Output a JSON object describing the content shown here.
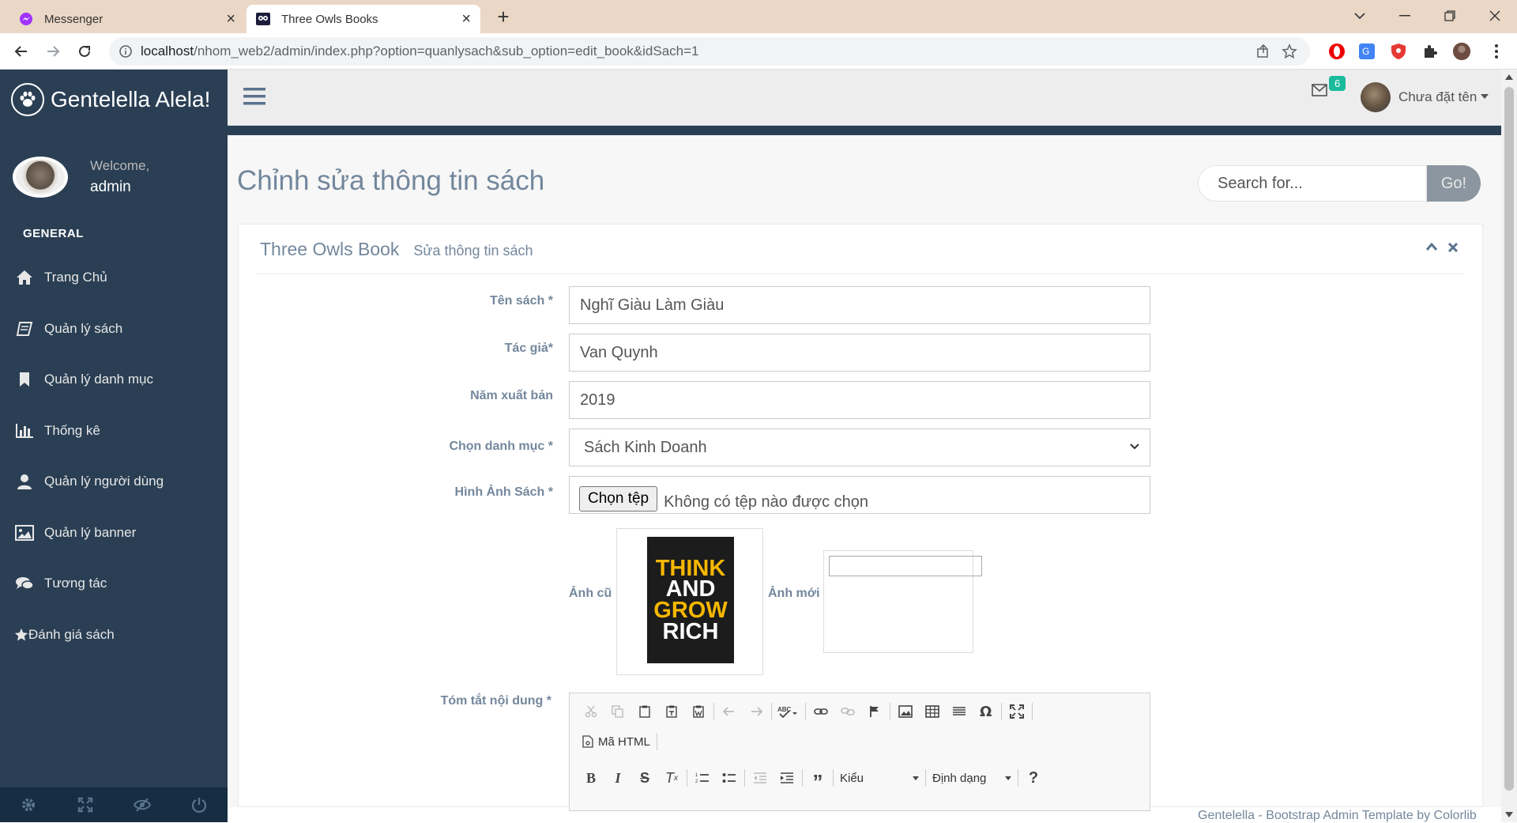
{
  "browser": {
    "tabs": [
      {
        "label": "Messenger",
        "active": false
      },
      {
        "label": "Three Owls Books",
        "active": true
      }
    ],
    "url_host": "localhost",
    "url_path": "/nhom_web2/admin/index.php?option=quanlysach&sub_option=edit_book&idSach=1"
  },
  "sidebar": {
    "brand": "Gentelella Alela!",
    "welcome": "Welcome,",
    "username": "admin",
    "section": "GENERAL",
    "items": [
      {
        "label": "Trang Chủ",
        "icon": "home-icon"
      },
      {
        "label": "Quản lý sách",
        "icon": "book-icon"
      },
      {
        "label": "Quản lý danh mục",
        "icon": "bookmark-icon"
      },
      {
        "label": "Thống kê",
        "icon": "bar-chart-icon"
      },
      {
        "label": "Quản lý người dùng",
        "icon": "user-icon"
      },
      {
        "label": "Quản lý banner",
        "icon": "image-icon"
      },
      {
        "label": "Tương tác",
        "icon": "comments-icon"
      },
      {
        "label": "Đánh giá sách",
        "icon": "star-icon"
      }
    ]
  },
  "topnav": {
    "mail_count": "6",
    "user_name": "Chưa đặt tên"
  },
  "page": {
    "title": "Chỉnh sửa thông tin sách",
    "search_placeholder": "Search for...",
    "search_button": "Go!"
  },
  "panel": {
    "title": "Three Owls Book",
    "subtitle": "Sửa thông tin sách"
  },
  "form": {
    "name_label": "Tên sách *",
    "name_value": "Nghĩ Giàu Làm Giàu",
    "author_label": "Tác giả*",
    "author_value": "Van Quynh",
    "year_label": "Năm xuất bản",
    "year_value": "2019",
    "category_label": "Chọn danh mục *",
    "category_value": "Sách Kinh Doanh",
    "image_label": "Hình Ảnh Sách *",
    "file_button": "Chọn tệp",
    "file_status": "Không có tệp nào được chọn",
    "old_image_label": "Ảnh cũ",
    "new_image_label": "Ảnh mới",
    "book_cover_lines": [
      "THINK",
      "AND",
      "GROW",
      "RICH"
    ],
    "summary_label": "Tóm tắt nội dung *"
  },
  "editor": {
    "source_label": "Mã HTML",
    "styles_label": "Kiểu",
    "format_label": "Định dạng",
    "help_label": "?"
  },
  "footer": {
    "text": "Gentelella - Bootstrap Admin Template by Colorlib"
  },
  "colors": {
    "sidebar": "#2a3f54",
    "accent_badge": "#1abb9c",
    "text_muted": "#73879c"
  }
}
